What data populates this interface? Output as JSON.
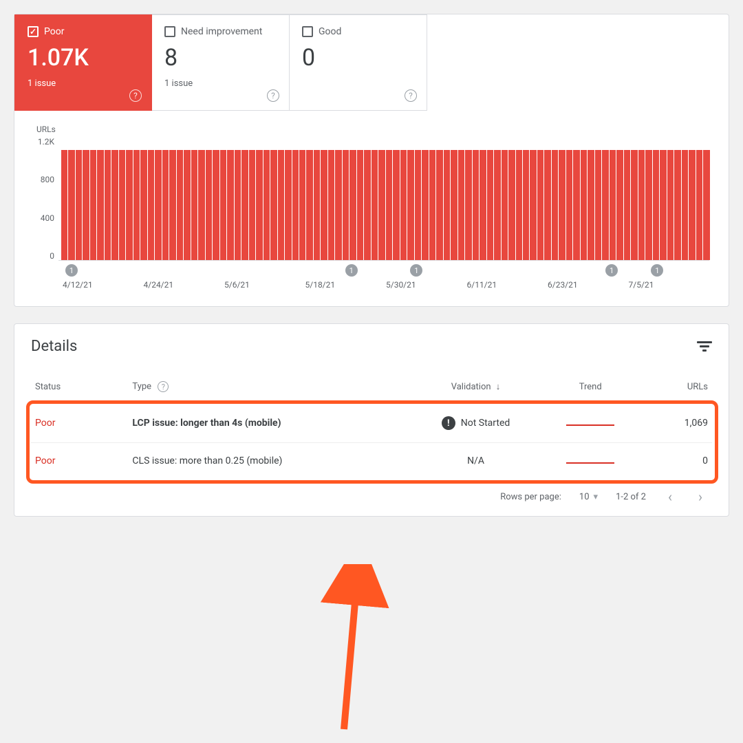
{
  "summary": {
    "poor": {
      "label": "Poor",
      "value": "1.07K",
      "sub": "1 issue",
      "checked": true
    },
    "need": {
      "label": "Need improvement",
      "value": "8",
      "sub": "1 issue",
      "checked": false
    },
    "good": {
      "label": "Good",
      "value": "0",
      "sub": "",
      "checked": false
    }
  },
  "chart_data": {
    "type": "bar",
    "title": "URLs",
    "ylabel": "",
    "ylim": [
      0,
      1200
    ],
    "y_ticks": [
      "1.2K",
      "800",
      "400",
      "0"
    ],
    "x_ticks": [
      "4/12/21",
      "4/24/21",
      "5/6/21",
      "5/18/21",
      "5/30/21",
      "6/11/21",
      "6/23/21",
      "7/5/21"
    ],
    "values": [
      1070,
      1070,
      1070,
      1070,
      1070,
      1070,
      1070,
      1070,
      1070,
      1070,
      1070,
      1070,
      1070,
      1070,
      1070,
      1070,
      1070,
      1070,
      1070,
      1070,
      1070,
      1070,
      1070,
      1070,
      1070,
      1070,
      1070,
      1070,
      1070,
      1070,
      1070,
      1070,
      1070,
      1070,
      1070,
      1070,
      1070,
      1070,
      1070,
      1070,
      1070,
      1070,
      1070,
      1070,
      1070,
      1070,
      1070,
      1070,
      1070,
      1070,
      1070,
      1070,
      1070,
      1070,
      1070,
      1070,
      1070,
      1070,
      1070,
      1070,
      1070,
      1070,
      1070,
      1070,
      1070,
      1070,
      1070,
      1070,
      1070,
      1070,
      1070,
      1070,
      1070,
      1070,
      1070,
      1070,
      1070,
      1070,
      1070,
      1070,
      1070,
      1070,
      1070,
      1070,
      1070,
      1070,
      1070,
      1070,
      1070,
      1070
    ],
    "markers": [
      {
        "pos_pct": 2,
        "label": "1"
      },
      {
        "pos_pct": 45,
        "label": "1"
      },
      {
        "pos_pct": 55,
        "label": "1"
      },
      {
        "pos_pct": 85,
        "label": "1"
      },
      {
        "pos_pct": 92,
        "label": "1"
      }
    ]
  },
  "details": {
    "title": "Details",
    "columns": {
      "status": "Status",
      "type": "Type",
      "validation": "Validation",
      "trend": "Trend",
      "urls": "URLs"
    },
    "rows": [
      {
        "status": "Poor",
        "type": "LCP issue: longer than 4s (mobile)",
        "bold": true,
        "validation": "Not Started",
        "validation_icon": true,
        "urls": "1,069"
      },
      {
        "status": "Poor",
        "type": "CLS issue: more than 0.25 (mobile)",
        "bold": false,
        "validation": "N/A",
        "validation_icon": false,
        "urls": "0"
      }
    ],
    "pager": {
      "rows_label": "Rows per page:",
      "rows_value": "10",
      "range": "1-2 of 2"
    }
  }
}
